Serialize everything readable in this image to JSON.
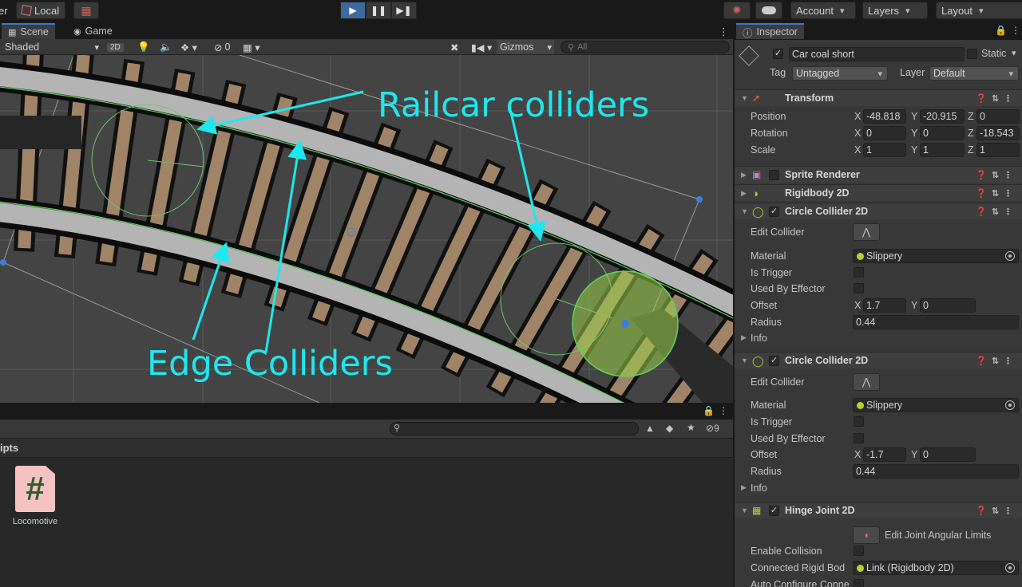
{
  "toolbar": {
    "left_label": "er",
    "pivot_label": "Local",
    "account_label": "Account",
    "layers_label": "Layers",
    "layout_label": "Layout"
  },
  "scene": {
    "tab_scene": "Scene",
    "tab_game": "Game",
    "shading_mode": "Shaded",
    "mode_2d": "2D",
    "hidden_count": "0",
    "gizmos_label": "Gizmos",
    "search_placeholder": "All",
    "annotation_railcar": "Railcar colliders",
    "annotation_edge": "Edge Colliders"
  },
  "project": {
    "breadcrumb": "ipts",
    "badge_count": "9",
    "asset_icon_glyph": "#",
    "asset_label": "Locomotive"
  },
  "inspector": {
    "tab_label": "Inspector",
    "object_name": "Car coal short",
    "static_label": "Static",
    "tag_label": "Tag",
    "tag_value": "Untagged",
    "layer_label": "Layer",
    "layer_value": "Default",
    "transform": {
      "title": "Transform",
      "position_label": "Position",
      "rotation_label": "Rotation",
      "scale_label": "Scale",
      "position": {
        "x": "-48.818",
        "y": "-20.915",
        "z": "0"
      },
      "rotation": {
        "x": "0",
        "y": "0",
        "z": "-18.543"
      },
      "scale": {
        "x": "1",
        "y": "1",
        "z": "1"
      }
    },
    "sprite_renderer": {
      "title": "Sprite Renderer"
    },
    "rigidbody": {
      "title": "Rigidbody 2D"
    },
    "circle1": {
      "title": "Circle Collider 2D",
      "edit_collider_label": "Edit Collider",
      "material_label": "Material",
      "material_value": "Slippery",
      "is_trigger_label": "Is Trigger",
      "used_by_effector_label": "Used By Effector",
      "offset_label": "Offset",
      "offset_x": "1.7",
      "offset_y": "0",
      "radius_label": "Radius",
      "radius_value": "0.44",
      "info_label": "Info"
    },
    "circle2": {
      "title": "Circle Collider 2D",
      "edit_collider_label": "Edit Collider",
      "material_label": "Material",
      "material_value": "Slippery",
      "is_trigger_label": "Is Trigger",
      "used_by_effector_label": "Used By Effector",
      "offset_label": "Offset",
      "offset_x": "-1.7",
      "offset_y": "0",
      "radius_label": "Radius",
      "radius_value": "0.44",
      "info_label": "Info"
    },
    "hinge": {
      "title": "Hinge Joint 2D",
      "edit_limits_label": "Edit Joint Angular Limits",
      "enable_collision_label": "Enable Collision",
      "connected_body_label": "Connected Rigid Bod",
      "connected_body_value": "Link (Rigidbody 2D)",
      "auto_configure_label": "Auto Configure Conne"
    },
    "axis": {
      "x": "X",
      "y": "Y",
      "z": "Z"
    }
  },
  "colors": {
    "accent_blue": "#3a78d6",
    "annotation_cyan": "#1ee8ee",
    "collider_green": "#5ed25e"
  }
}
